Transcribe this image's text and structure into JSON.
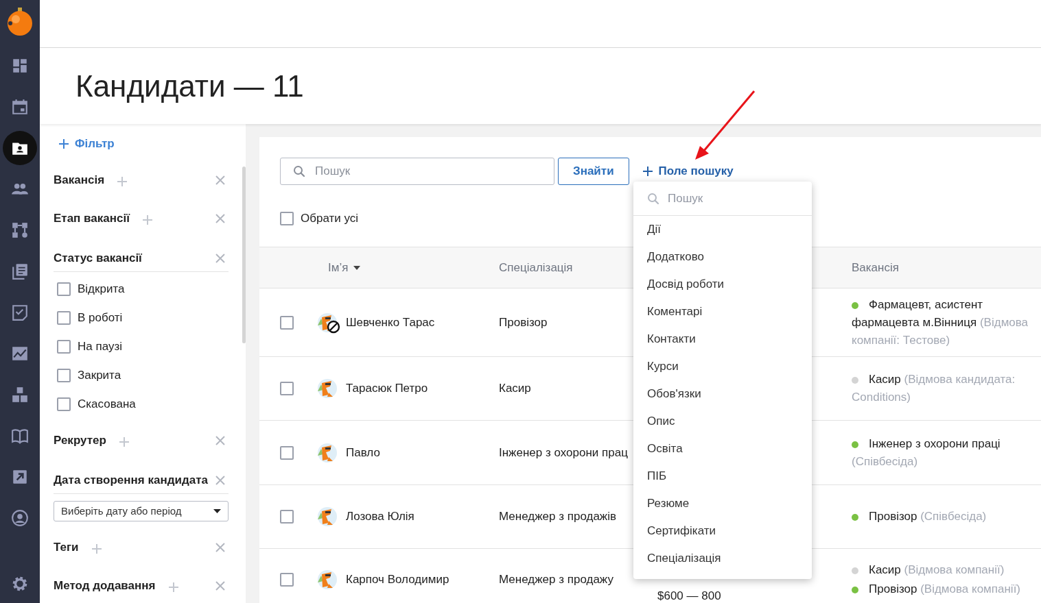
{
  "nav": {
    "items": [
      {
        "selected": false
      },
      {
        "selected": false
      },
      {
        "selected": true
      },
      {
        "selected": false
      },
      {
        "selected": false
      },
      {
        "selected": false
      },
      {
        "selected": false
      },
      {
        "selected": false
      },
      {
        "selected": false
      },
      {
        "selected": false
      },
      {
        "selected": false
      },
      {
        "selected": false
      }
    ]
  },
  "header": {
    "title": "Кандидати — 11"
  },
  "filters": {
    "add_label": "Фільтр",
    "sections": [
      {
        "kind": "adder",
        "label": "Вакансія"
      },
      {
        "kind": "adder",
        "label": "Етап вакансії"
      },
      {
        "kind": "checklist",
        "label": "Статус вакансії",
        "options": [
          {
            "label": "Відкрита",
            "checked": false
          },
          {
            "label": "В роботі",
            "checked": false
          },
          {
            "label": "На паузі",
            "checked": false
          },
          {
            "label": "Закрита",
            "checked": false
          },
          {
            "label": "Скасована",
            "checked": false
          }
        ]
      },
      {
        "kind": "adder",
        "label": "Рекрутер"
      },
      {
        "kind": "date",
        "label": "Дата створення кандидата",
        "placeholder": "Виберіть дату або період"
      },
      {
        "kind": "adder",
        "label": "Теги"
      },
      {
        "kind": "adder",
        "label": "Метод додавання"
      }
    ]
  },
  "search": {
    "placeholder": "Пошук",
    "button": "Знайти",
    "add_field": "Поле пошуку"
  },
  "select_all": {
    "label": "Обрати усі",
    "checked": false
  },
  "table": {
    "columns": [
      {
        "label": "Ім’я",
        "sorted": true
      },
      {
        "label": "Спеціалізація",
        "sorted": false
      },
      {
        "label": "Вакансія",
        "sorted": false
      }
    ],
    "rows": [
      {
        "checked": false,
        "name": "Шевченко Тарас",
        "blocked": true,
        "specialization": "Провізор",
        "vacancies": [
          {
            "title": "Фармацевт, асистент фармацевта м.Вінниця",
            "status": "(Відмова компанії: Тестове)",
            "color": "#7ac143"
          }
        ]
      },
      {
        "checked": false,
        "name": "Тарасюк Петро",
        "blocked": false,
        "specialization": "Касир",
        "vacancies": [
          {
            "title": "Касир",
            "status": "(Відмова кандидата: Conditions)",
            "color": "#d4d4d4"
          }
        ]
      },
      {
        "checked": false,
        "name": "Павло",
        "blocked": false,
        "specialization": "Інженер з охорони прац",
        "vacancies": [
          {
            "title": "Інженер з охорони праці",
            "status": "(Співбесіда)",
            "color": "#7ac143"
          }
        ]
      },
      {
        "checked": false,
        "name": "Лозова Юлія",
        "blocked": false,
        "specialization": "Менеджер з продажів",
        "vacancies": [
          {
            "title": "Провізор",
            "status": "(Співбесіда)",
            "color": "#7ac143"
          }
        ]
      },
      {
        "checked": false,
        "name": "Карпоч Володимир",
        "blocked": false,
        "specialization": "Менеджер з продажу",
        "column_3": "$600 — 800",
        "vacancies": [
          {
            "title": "Касир",
            "status": "(Відмова компанії)",
            "color": "#d4d4d4"
          },
          {
            "title": "Провізор",
            "status": "(Відмова компанії)",
            "color": "#7ac143"
          }
        ]
      }
    ]
  },
  "dropdown": {
    "search_placeholder": "Пошук",
    "items": [
      "Дії",
      "Додатково",
      "Досвід роботи",
      "Коментарі",
      "Контакти",
      "Курси",
      "Обов'язки",
      "Опис",
      "Освіта",
      "ПІБ",
      "Резюме",
      "Сертифікати",
      "Спеціалізація"
    ]
  }
}
